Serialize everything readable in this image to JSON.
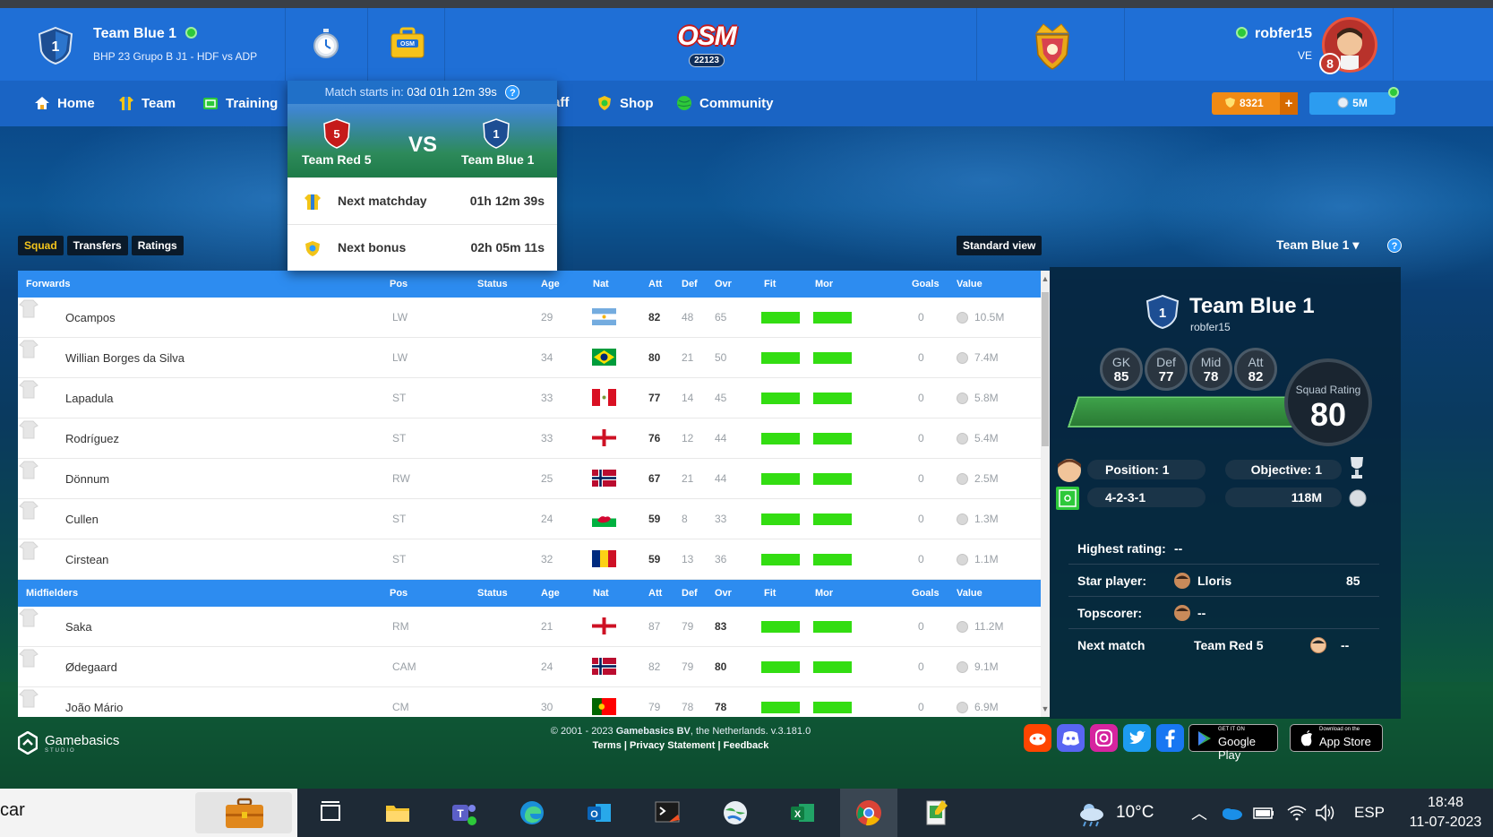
{
  "header": {
    "team_name": "Team Blue 1",
    "team_league": "BHP 23 Grupo B J1 - HDF vs ADP",
    "logo_text": "OSM",
    "logo_number": "22123",
    "username": "robfer15",
    "country": "VE",
    "level": "8"
  },
  "nav": {
    "items": [
      {
        "label": "Home",
        "icon": "home-icon"
      },
      {
        "label": "Team",
        "icon": "shirt-icon"
      },
      {
        "label": "Training",
        "icon": "training-icon"
      },
      {
        "label": "Staff",
        "icon": "staff-icon"
      },
      {
        "label": "Shop",
        "icon": "shop-icon"
      },
      {
        "label": "Community",
        "icon": "globe-icon"
      }
    ],
    "coins": "8321",
    "coins_plus": "+",
    "money": "5M"
  },
  "popup": {
    "match_starts_label": "Match starts in:",
    "match_starts_value": "03d 01h 12m 39s",
    "help": "?",
    "home_team": "Team Red 5",
    "home_number": "5",
    "vs": "VS",
    "away_team": "Team Blue 1",
    "away_number": "1",
    "rows": [
      {
        "label": "Next matchday",
        "value": "01h 12m 39s"
      },
      {
        "label": "Next bonus",
        "value": "02h 05m 11s"
      }
    ]
  },
  "tabs": [
    "Squad",
    "Transfers",
    "Ratings"
  ],
  "standard_view": "Standard view",
  "team_selector": "Team Blue 1 ▾",
  "columns": {
    "pos": "Pos",
    "status": "Status",
    "age": "Age",
    "nat": "Nat",
    "att": "Att",
    "def": "Def",
    "ovr": "Ovr",
    "fit": "Fit",
    "mor": "Mor",
    "goals": "Goals",
    "value": "Value"
  },
  "sections": [
    {
      "title": "Forwards",
      "players": [
        {
          "name": "Ocampos",
          "pos": "LW",
          "age": "29",
          "nat": "argentina",
          "att": "82",
          "def": "48",
          "ovr": "65",
          "goals": "0",
          "value": "10.5M",
          "bold": "att"
        },
        {
          "name": "Willian Borges da Silva",
          "pos": "LW",
          "age": "34",
          "nat": "brazil",
          "att": "80",
          "def": "21",
          "ovr": "50",
          "goals": "0",
          "value": "7.4M",
          "bold": "att"
        },
        {
          "name": "Lapadula",
          "pos": "ST",
          "age": "33",
          "nat": "peru",
          "att": "77",
          "def": "14",
          "ovr": "45",
          "goals": "0",
          "value": "5.8M",
          "bold": "att"
        },
        {
          "name": "Rodríguez",
          "pos": "ST",
          "age": "33",
          "nat": "england",
          "att": "76",
          "def": "12",
          "ovr": "44",
          "goals": "0",
          "value": "5.4M",
          "bold": "att"
        },
        {
          "name": "Dönnum",
          "pos": "RW",
          "age": "25",
          "nat": "norway",
          "att": "67",
          "def": "21",
          "ovr": "44",
          "goals": "0",
          "value": "2.5M",
          "bold": "att"
        },
        {
          "name": "Cullen",
          "pos": "ST",
          "age": "24",
          "nat": "wales",
          "att": "59",
          "def": "8",
          "ovr": "33",
          "goals": "0",
          "value": "1.3M",
          "bold": "att"
        },
        {
          "name": "Cirstean",
          "pos": "ST",
          "age": "32",
          "nat": "romania",
          "att": "59",
          "def": "13",
          "ovr": "36",
          "goals": "0",
          "value": "1.1M",
          "bold": "att"
        }
      ]
    },
    {
      "title": "Midfielders",
      "players": [
        {
          "name": "Saka",
          "pos": "RM",
          "age": "21",
          "nat": "england",
          "att": "87",
          "def": "79",
          "ovr": "83",
          "goals": "0",
          "value": "11.2M",
          "bold": "ovr"
        },
        {
          "name": "Ødegaard",
          "pos": "CAM",
          "age": "24",
          "nat": "norway",
          "att": "82",
          "def": "79",
          "ovr": "80",
          "goals": "0",
          "value": "9.1M",
          "bold": "ovr"
        },
        {
          "name": "João Mário",
          "pos": "CM",
          "age": "30",
          "nat": "portugal",
          "att": "79",
          "def": "78",
          "ovr": "78",
          "goals": "0",
          "value": "6.9M",
          "bold": "ovr"
        }
      ]
    }
  ],
  "panel": {
    "team_name": "Team Blue 1",
    "username": "robfer15",
    "badge_number": "1",
    "ratings": [
      {
        "label": "GK",
        "value": "85"
      },
      {
        "label": "Def",
        "value": "77"
      },
      {
        "label": "Mid",
        "value": "78"
      },
      {
        "label": "Att",
        "value": "82"
      }
    ],
    "squad_rating_label": "Squad Rating",
    "squad_rating": "80",
    "position": "Position: 1",
    "objective": "Objective: 1",
    "formation": "4-2-3-1",
    "budget": "118M",
    "highest_rating_label": "Highest rating:",
    "highest_rating_value": "--",
    "star_player_label": "Star player:",
    "star_player_name": "Lloris",
    "star_player_value": "85",
    "topscorer_label": "Topscorer:",
    "topscorer_value": "--",
    "next_match_label": "Next match",
    "next_match_team": "Team Red 5",
    "next_match_value": "--"
  },
  "footer": {
    "brand": "Gamebasics",
    "brand_sub": "STUDIO",
    "copyright_prefix": "© 2001 - 2023 ",
    "copyright_brand": "Gamebasics BV",
    "copyright_suffix": ", the Netherlands. v.3.181.0",
    "links": [
      "Terms",
      "Privacy Statement",
      "Feedback"
    ],
    "google_small": "GET IT ON",
    "google": "Google Play",
    "apple_small": "Download on the",
    "apple": "App Store"
  },
  "taskbar": {
    "search_text": "car",
    "temperature": "10°C",
    "language": "ESP",
    "time": "18:48",
    "date": "11-07-2023"
  },
  "colors": {
    "header_blue": "#1f6fd6",
    "table_header": "#2d8cf0",
    "bar_green": "#33dd12",
    "coins_orange": "#f08a14",
    "money_blue": "#2c9cf0",
    "active_tab": "#f4c51c"
  }
}
